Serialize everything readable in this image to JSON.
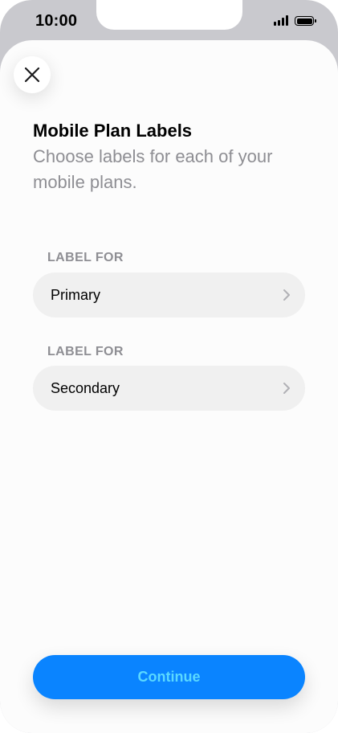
{
  "status_bar": {
    "time": "10:00",
    "icons": [
      "cellular-signal-icon",
      "battery-icon"
    ]
  },
  "sheet": {
    "close_icon": "close-icon",
    "title": "Mobile Plan Labels",
    "subtitle": "Choose labels for each of your mobile plans."
  },
  "plans": [
    {
      "section_label": "LABEL FOR",
      "value": "Primary"
    },
    {
      "section_label": "LABEL FOR",
      "value": "Secondary"
    }
  ],
  "footer": {
    "continue_label": "Continue"
  },
  "colors": {
    "accent": "#0a84ff",
    "accent_text": "#5ad8ff",
    "secondary_text": "#8e8e93",
    "row_background": "#f0f0f0"
  }
}
